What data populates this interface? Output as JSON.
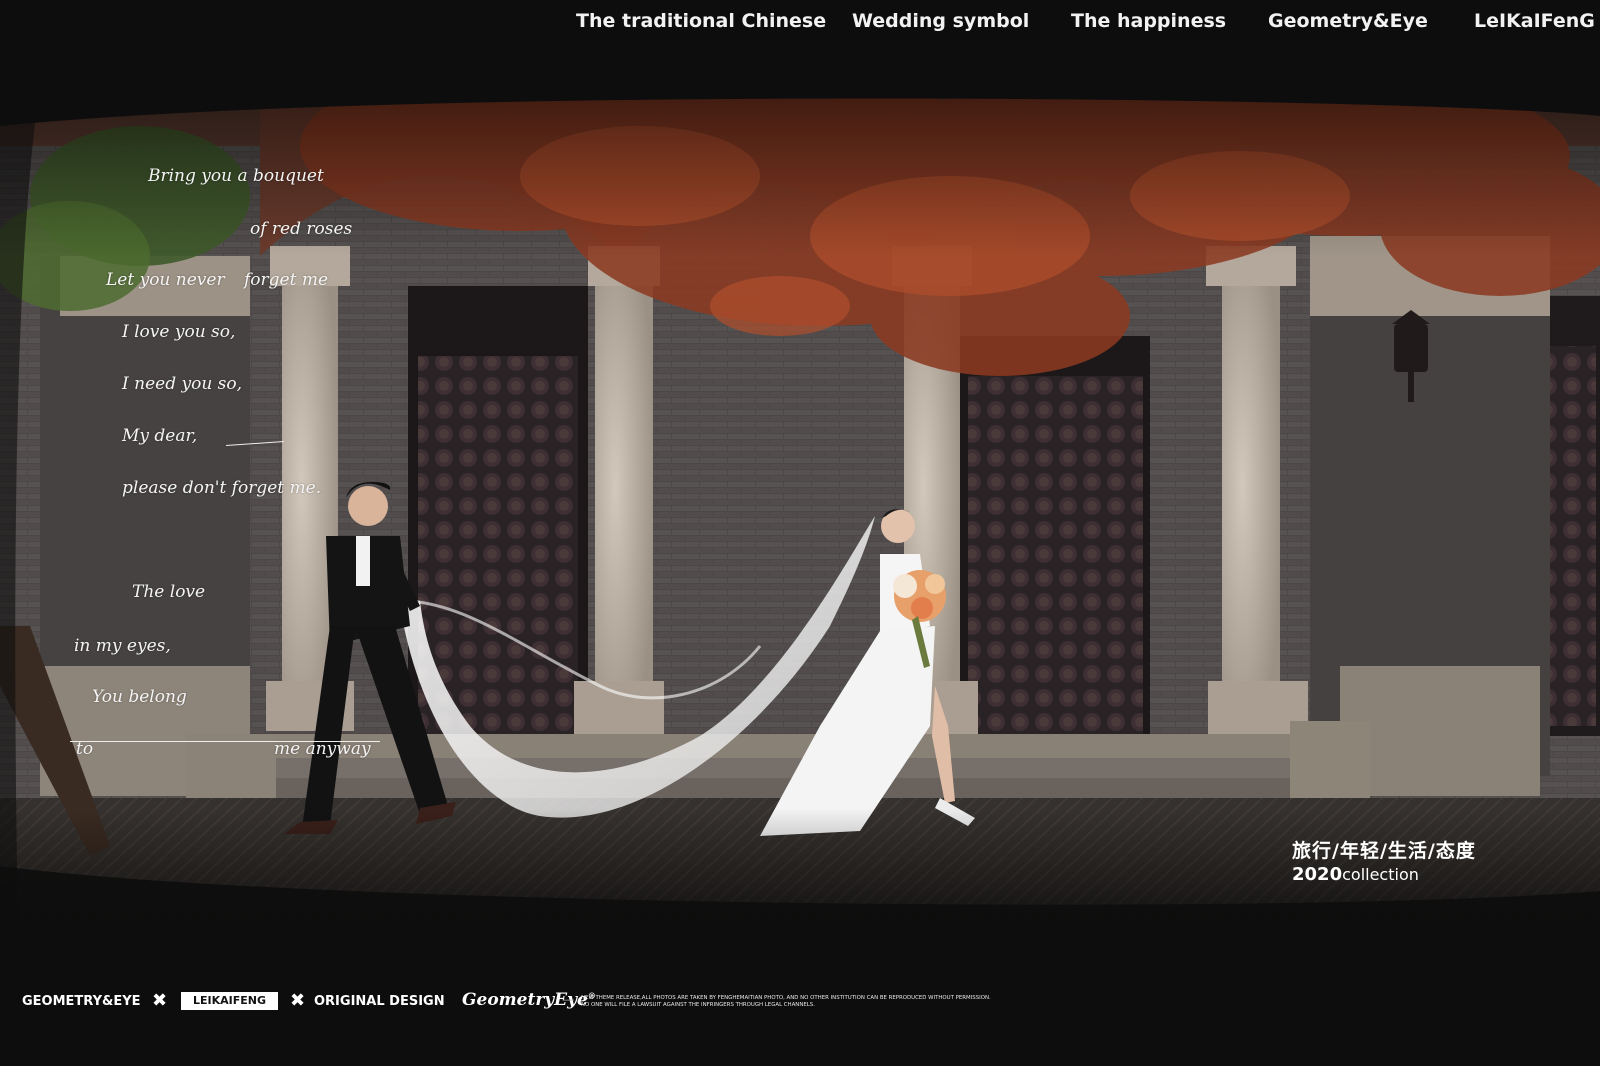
{
  "nav": {
    "items": [
      "The traditional Chinese",
      "Wedding symbol",
      "The happiness",
      "Geometry&Eye",
      "LeIKaIFenG"
    ]
  },
  "poem": {
    "lines": [
      "Bring you a bouquet",
      "of red roses",
      "Let you never",
      "forget me",
      "I love you so,",
      "I need you so,",
      "My dear,",
      "please don't forget me.",
      "The love",
      "in my eyes,",
      "You belong",
      "to",
      "me anyway"
    ]
  },
  "caption": {
    "cn": "旅行/年轻/生活/态度",
    "year": "2020",
    "collection": "collection"
  },
  "footer": {
    "brand": "GEOMETRY&EYE",
    "sep": "✖",
    "boxed": "LEIKAIFENG",
    "original": "ORIGINAL DESIGN",
    "logo": "GeometryEye",
    "logo_mark": "®",
    "dash": "—",
    "notice_1": "NEW THEME RELEASE,ALL PHOTOS ARE TAKEN BY FENGHEMAITIAN PHOTO, AND NO OTHER INSTITUTION CAN BE REPRODUCED WITHOUT PERMISSION.",
    "notice_2": "NO ONE WILL FILE A LAWSUIT AGAINST THE INFRINGERS THROUGH LEGAL CHANNELS."
  },
  "colors": {
    "frame": "#0d0d0d",
    "brick": "#4a4646",
    "stone": "#b7aca0",
    "leaves": "#8a3a22",
    "floor": "#3b3633"
  }
}
